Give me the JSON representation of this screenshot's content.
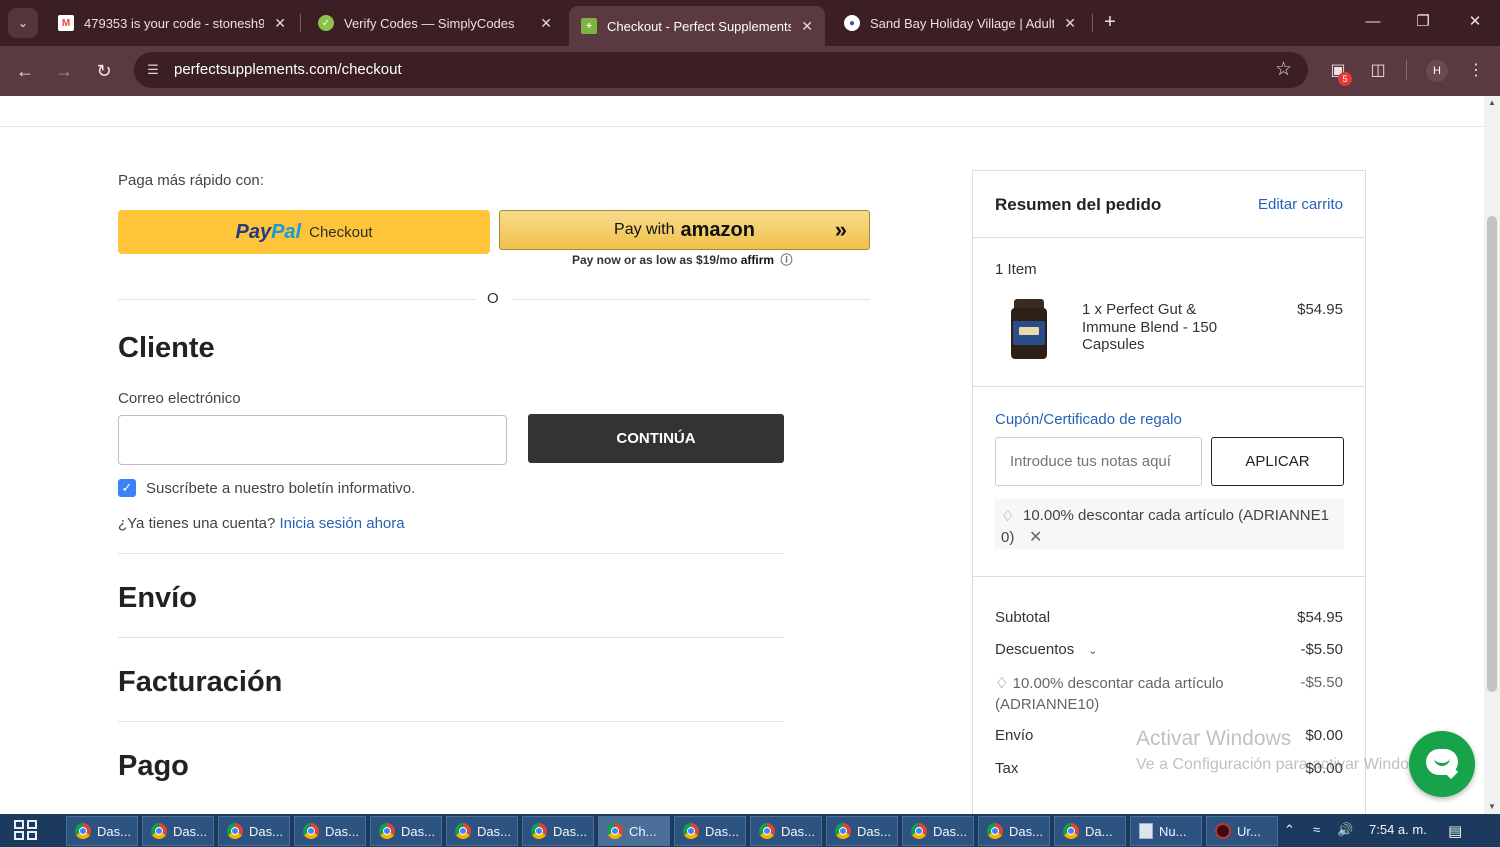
{
  "browser": {
    "tabs": [
      {
        "title": "479353 is your code - stonesh9",
        "favicon": "gmail-icon",
        "color": "#ea4335"
      },
      {
        "title": "Verify Codes — SimplyCodes",
        "favicon": "simplycodes-icon",
        "color": "#8bc34a"
      },
      {
        "title": "Checkout - Perfect Supplements",
        "favicon": "perfect-supplements-icon",
        "color": "#7cb342"
      },
      {
        "title": "Sand Bay Holiday Village | Adult",
        "favicon": "sandbay-icon",
        "color": "#ffffff"
      }
    ],
    "url": "perfectsupplements.com/checkout",
    "extension_badge": "5",
    "profile_initial": "H"
  },
  "express": {
    "label": "Paga más rápido con:",
    "paypal_pay": "Pay",
    "paypal_pal": "Pal",
    "paypal_checkout": "Checkout",
    "amazon_text": "Pay with",
    "amazon_logo": "amazon",
    "affirm_text": "Pay now or as low as $19/mo",
    "affirm_logo": "affirm",
    "or": "O"
  },
  "customer": {
    "heading": "Cliente",
    "email_label": "Correo electrónico",
    "email_value": "",
    "continue_label": "CONTINÚA",
    "newsletter_label": "Suscríbete a nuestro boletín informativo.",
    "newsletter_checked": true,
    "account_question": "¿Ya tienes una cuenta?",
    "signin_link": "Inicia sesión ahora"
  },
  "sections": {
    "shipping": "Envío",
    "billing": "Facturación",
    "payment": "Pago"
  },
  "summary": {
    "title": "Resumen del pedido",
    "edit_cart": "Editar carrito",
    "item_count": "1 Item",
    "item_name": "1 x Perfect Gut & Immune Blend - 150 Capsules",
    "item_price": "$54.95",
    "coupon_label": "Cupón/Certificado de regalo",
    "coupon_placeholder": "Introduce tus notas aquí",
    "apply_label": "APLICAR",
    "applied_discount_line1": "10.00% descontar cada artículo (ADRIANNE1",
    "applied_discount_line2": "0)",
    "subtotal_label": "Subtotal",
    "subtotal_value": "$54.95",
    "discounts_label": "Descuentos",
    "discounts_value": "-$5.50",
    "discount_detail": "10.00% descontar cada artículo (ADRIANNE10)",
    "discount_detail_value": "-$5.50",
    "shipping_label": "Envío",
    "shipping_value": "$0.00",
    "tax_label": "Tax",
    "tax_value": "$0.00"
  },
  "watermark": {
    "line1": "Activar Windows",
    "line2": "Ve a Configuración para activar Windows."
  },
  "taskbar": {
    "items": [
      "Das...",
      "Das...",
      "Das...",
      "Das...",
      "Das...",
      "Das...",
      "Das...",
      "Ch...",
      "Das...",
      "Das...",
      "Das...",
      "Das...",
      "Das...",
      "Da...",
      "Nu...",
      "Ur..."
    ],
    "clock": "7:54 a. m."
  }
}
